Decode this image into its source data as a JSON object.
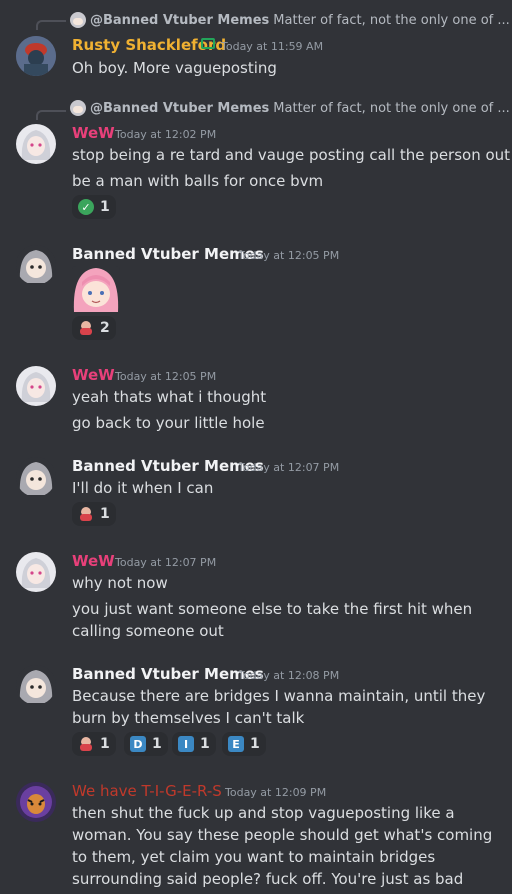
{
  "messages": [
    {
      "reply": {
        "name": "@Banned Vtuber Memes",
        "text": "Matter of fact, not the only one of ..."
      },
      "author": "Rusty Shackleford",
      "author_color": "#f0b132",
      "time": "Today at 11:59 AM",
      "lines": [
        "Oh boy. More vagueposting"
      ]
    },
    {
      "reply": {
        "name": "@Banned Vtuber Memes",
        "text": "Matter of fact, not the only one of ..."
      },
      "author": "WeW",
      "author_color": "#e8407a",
      "time": "Today at 12:02 PM",
      "lines": [
        "stop being a re tard and vauge posting call the person out",
        "be a man with balls for once bvm"
      ],
      "reactions": [
        {
          "emoji": "check-mark",
          "count": "1"
        }
      ]
    },
    {
      "author": "Banned Vtuber Memes",
      "author_color": "#f2f3f5",
      "time": "Today at 12:05 PM",
      "reactions": [
        {
          "emoji": "girl-face",
          "count": "2"
        }
      ]
    },
    {
      "author": "WeW",
      "author_color": "#e8407a",
      "time": "Today at 12:05 PM",
      "lines": [
        "yeah thats what i thought",
        "go back to your little hole"
      ]
    },
    {
      "author": "Banned Vtuber Memes",
      "author_color": "#f2f3f5",
      "time": "Today at 12:07 PM",
      "lines": [
        "I'll do it when I can"
      ],
      "reactions": [
        {
          "emoji": "girl-face",
          "count": "1"
        }
      ]
    },
    {
      "author": "WeW",
      "author_color": "#e8407a",
      "time": "Today at 12:07 PM",
      "lines": [
        "why not now",
        "you just want someone else to take the first hit when",
        "calling someone out"
      ]
    },
    {
      "author": "Banned Vtuber Memes",
      "author_color": "#f2f3f5",
      "time": "Today at 12:08 PM",
      "lines": [
        "Because there are bridges I wanna maintain, until they",
        "burn by themselves I can't talk"
      ],
      "reactions": [
        {
          "emoji": "girl-face",
          "count": "1"
        },
        {
          "emoji": "D",
          "count": "1"
        },
        {
          "emoji": "I",
          "count": "1"
        },
        {
          "emoji": "E",
          "count": "1"
        }
      ]
    },
    {
      "author": "We have T-I-G-E-R-S",
      "author_color": "#c0392b",
      "time": "Today at 12:09 PM",
      "lines": [
        "then shut the fuck up and stop vagueposting like a",
        "woman. You say these people should get what's coming",
        "to them, yet claim you want to maintain bridges",
        "surrounding said people? fuck off. You're just as bad"
      ]
    }
  ]
}
